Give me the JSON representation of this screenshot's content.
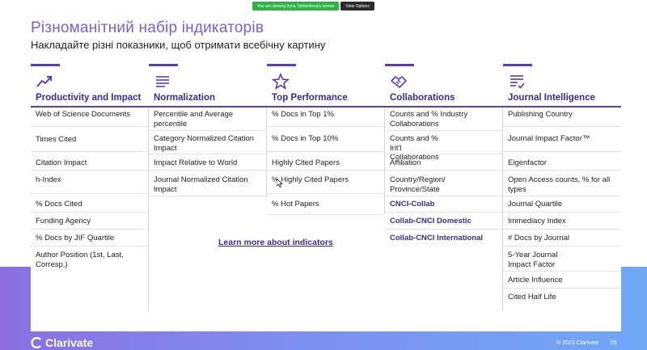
{
  "zoom": {
    "viewing_text": "You are viewing Iryna Tykhonkova's screen",
    "view_options": "View Options"
  },
  "slide": {
    "title": "Різноманітний набір індикаторів",
    "subtitle": "Накладайте різні показники, щоб отримати всебічну картину",
    "learn_more": "Learn more about indicators",
    "logo_text": "Clarivate",
    "copyright": "© 2023 Clarivate",
    "page_number": "23"
  },
  "columns": [
    {
      "icon": "trend-up-icon",
      "heading": "Productivity and Impact",
      "items": [
        {
          "text": "Web of Science Documents"
        },
        {
          "text": "Times Cited"
        },
        {
          "text": "Citation Impact"
        },
        {
          "text": "h-Index"
        },
        {
          "text": "% Docs Cited"
        },
        {
          "text": "Funding Agency"
        },
        {
          "text": "% Docs by JIF Quartile"
        },
        {
          "text": "Author Position (1st, Last, Corresp.)"
        }
      ]
    },
    {
      "icon": "text-lines-icon",
      "heading": "Normalization",
      "items": [
        {
          "text": "Percentile and Average percentile"
        },
        {
          "text": "Category Normalized Citation Impact"
        },
        {
          "text": "Impact Relative to World"
        },
        {
          "text": "Journal Normalized Citation Impact"
        }
      ]
    },
    {
      "icon": "star-icon",
      "heading": "Top Performance",
      "items": [
        {
          "text": "% Docs in Top 1%"
        },
        {
          "text": "% Docs in Top 10%"
        },
        {
          "text": "Highly Cited Papers"
        },
        {
          "text": "% Highly Cited Papers"
        },
        {
          "text": "% Hot Papers"
        }
      ]
    },
    {
      "icon": "handshake-icon",
      "heading": "Collaborations",
      "items": [
        {
          "text": "Counts and % Industry Collaborations"
        },
        {
          "text": "Counts and % Int'l Collaborations"
        },
        {
          "text": "Affiliation"
        },
        {
          "text": "Country/Region/ Province/State"
        },
        {
          "text": "CNCI-Collab",
          "bold": true
        },
        {
          "text": "Collab-CNCI Domestic",
          "bold": true
        },
        {
          "text": "Collab-CNCI International",
          "bold": true
        }
      ]
    },
    {
      "icon": "checklist-icon",
      "heading": "Journal Intelligence",
      "items": [
        {
          "text": "Publishing Country"
        },
        {
          "text": "Journal Impact Factor™"
        },
        {
          "text": "Eigenfactor"
        },
        {
          "text": "Open Access counts, % for all types"
        },
        {
          "text": "Journal Quartile"
        },
        {
          "text": "Immediacy Index"
        },
        {
          "text": "# Docs by Journal"
        },
        {
          "text": "5-Year Journal Impact Factor"
        },
        {
          "text": "Article Influence"
        },
        {
          "text": "Cited Half Life"
        }
      ]
    }
  ],
  "colors": {
    "accent": "#5a3cc2",
    "title": "#7b5fd0",
    "heading": "#3d2a8e"
  }
}
